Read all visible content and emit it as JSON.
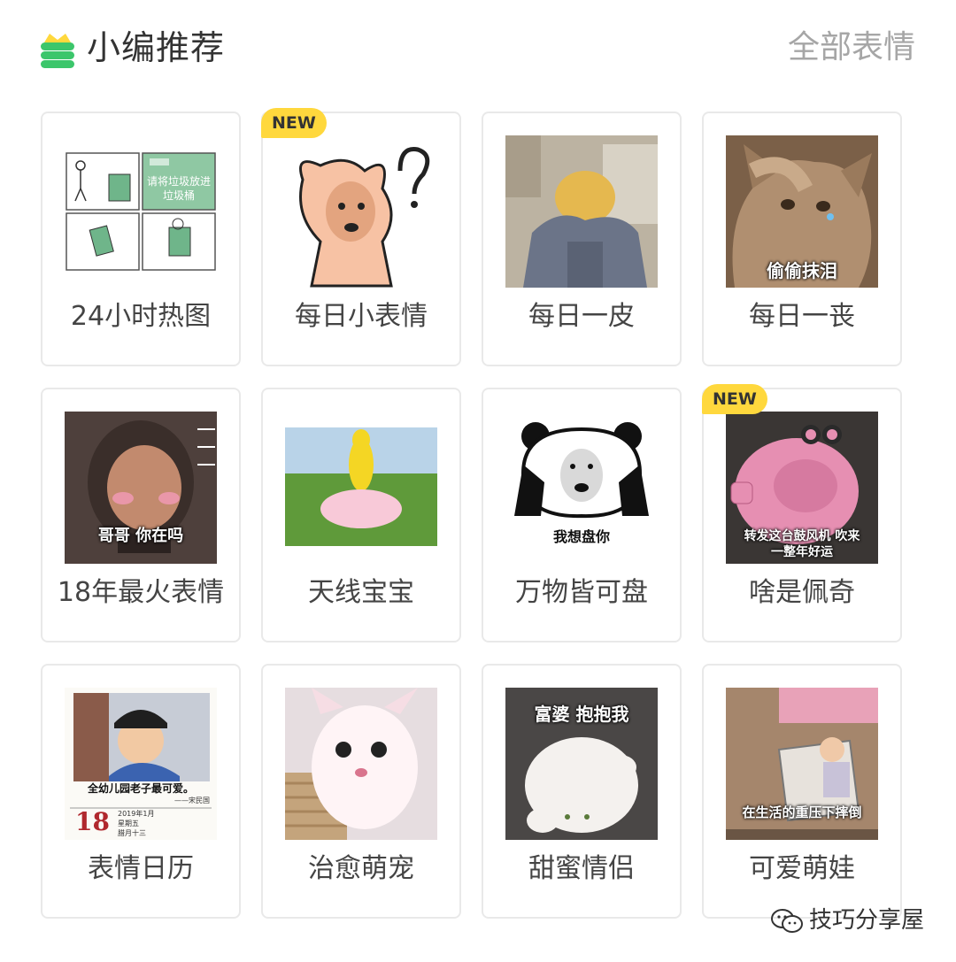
{
  "header": {
    "title": "小编推荐",
    "all_link": "全部表情",
    "logo_icon": "crown-stack-icon",
    "accent_green": "#3cc66b",
    "accent_yellow": "#ffd83d"
  },
  "badge_text": "NEW",
  "cards": [
    {
      "label": "24小时热图",
      "caption": "请将垃圾放进垃圾桶",
      "new": false
    },
    {
      "label": "每日小表情",
      "caption": "",
      "new": true
    },
    {
      "label": "每日一皮",
      "caption": "",
      "new": false
    },
    {
      "label": "每日一丧",
      "caption": "偷偷抹泪",
      "new": false
    },
    {
      "label": "18年最火表情",
      "caption": "哥哥 你在吗",
      "new": false
    },
    {
      "label": "天线宝宝",
      "caption": "",
      "new": false
    },
    {
      "label": "万物皆可盘",
      "caption": "我想盘你",
      "new": false
    },
    {
      "label": "啥是佩奇",
      "caption": "转发这台鼓风机 吹来一整年好运",
      "new": true
    },
    {
      "label": "表情日历",
      "caption": "全幼儿园老子最可爱。",
      "new": false
    },
    {
      "label": "治愈萌宠",
      "caption": "",
      "new": false
    },
    {
      "label": "甜蜜情侣",
      "caption": "富婆 抱抱我",
      "new": false
    },
    {
      "label": "可爱萌娃",
      "caption": "在生活的重压下摔倒",
      "new": false
    }
  ],
  "calendar": {
    "day": "18",
    "year_month": "2019年1月",
    "weekday": "星期五",
    "lunar": "腊月十三",
    "signature": "——宋民国"
  },
  "watermark": {
    "text": "技巧分享屋",
    "icon": "wechat-icon"
  }
}
